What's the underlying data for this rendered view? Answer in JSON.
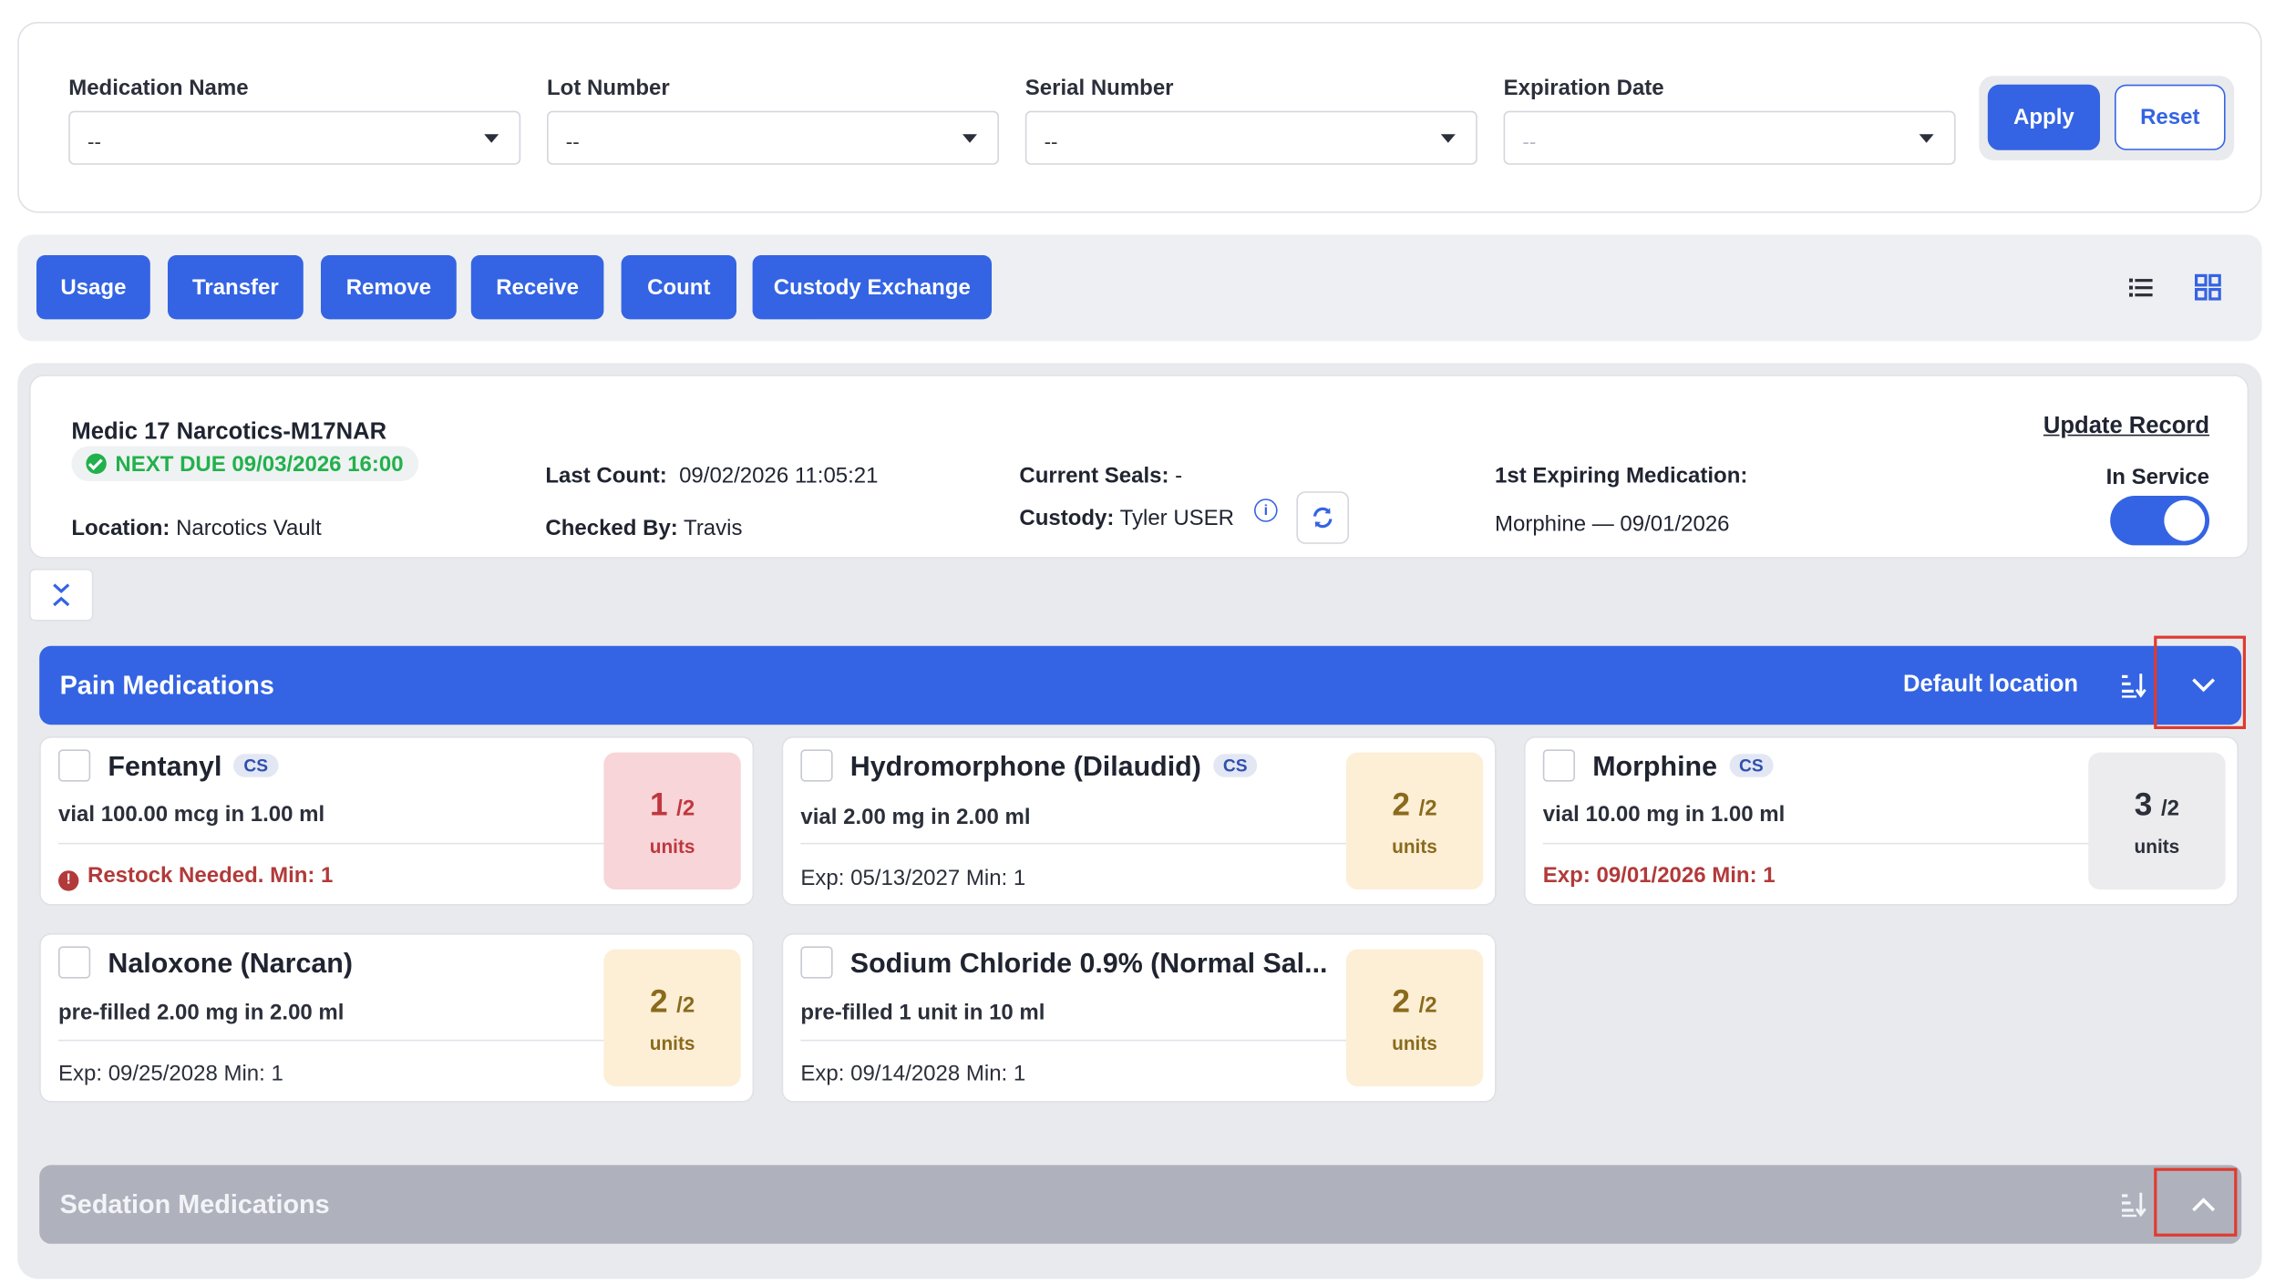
{
  "filters": [
    {
      "label": "Medication Name",
      "value": "--"
    },
    {
      "label": "Lot Number",
      "value": "--"
    },
    {
      "label": "Serial Number",
      "value": "--"
    },
    {
      "label": "Expiration Date",
      "value": "--"
    }
  ],
  "filter_actions": {
    "apply": "Apply",
    "reset": "Reset"
  },
  "actions": [
    "Usage",
    "Transfer",
    "Remove",
    "Receive",
    "Count",
    "Custody Exchange"
  ],
  "unit": {
    "name": "Medic 17 Narcotics-M17NAR",
    "next_due": "NEXT DUE 09/03/2026 16:00",
    "location_label": "Location:",
    "location": "Narcotics Vault",
    "last_count_label": "Last Count:",
    "last_count": "09/02/2026 11:05:21",
    "checked_by_label": "Checked By:",
    "checked_by": "Travis",
    "seals_label": "Current Seals:",
    "seals": "-",
    "custody_label": "Custody:",
    "custody": "Tyler USER",
    "first_expiring_label": "1st Expiring Medication:",
    "first_expiring": "Morphine — 09/01/2026",
    "update_record": "Update Record",
    "in_service_label": "In Service",
    "in_service": true
  },
  "groups": [
    {
      "title": "Pain Medications",
      "default_location": "Default location",
      "expanded": true
    },
    {
      "title": "Sedation Medications",
      "expanded": false
    }
  ],
  "medications": [
    {
      "name": "Fentanyl",
      "cs": "CS",
      "form": "vial 100.00 mcg in 1.00 ml",
      "status": "Restock Needed.  Min: 1",
      "qty": "1",
      "total": "/2",
      "unit": "units"
    },
    {
      "name": "Hydromorphone (Dilaudid)",
      "cs": "CS",
      "form": "vial 2.00 mg in 2.00 ml",
      "status": "Exp: 05/13/2027  Min: 1",
      "qty": "2",
      "total": "/2",
      "unit": "units"
    },
    {
      "name": "Morphine",
      "cs": "CS",
      "form": "vial 10.00 mg in 1.00 ml",
      "status": "Exp: 09/01/2026  Min: 1",
      "qty": "3",
      "total": "/2",
      "unit": "units"
    },
    {
      "name": "Naloxone (Narcan)",
      "form": "pre-filled 2.00 mg in 2.00 ml",
      "status": "Exp: 09/25/2028  Min: 1",
      "qty": "2",
      "total": "/2",
      "unit": "units"
    },
    {
      "name": "Sodium Chloride 0.9% (Normal Sal...",
      "form": "pre-filled 1 unit in 10 ml",
      "status": "Exp: 09/14/2028  Min: 1",
      "qty": "2",
      "total": "/2",
      "unit": "units"
    }
  ],
  "colors": {
    "primary": "#3464e3",
    "success": "#22b14c",
    "danger": "#b23a3a",
    "group_inactive": "#afb2bd"
  }
}
